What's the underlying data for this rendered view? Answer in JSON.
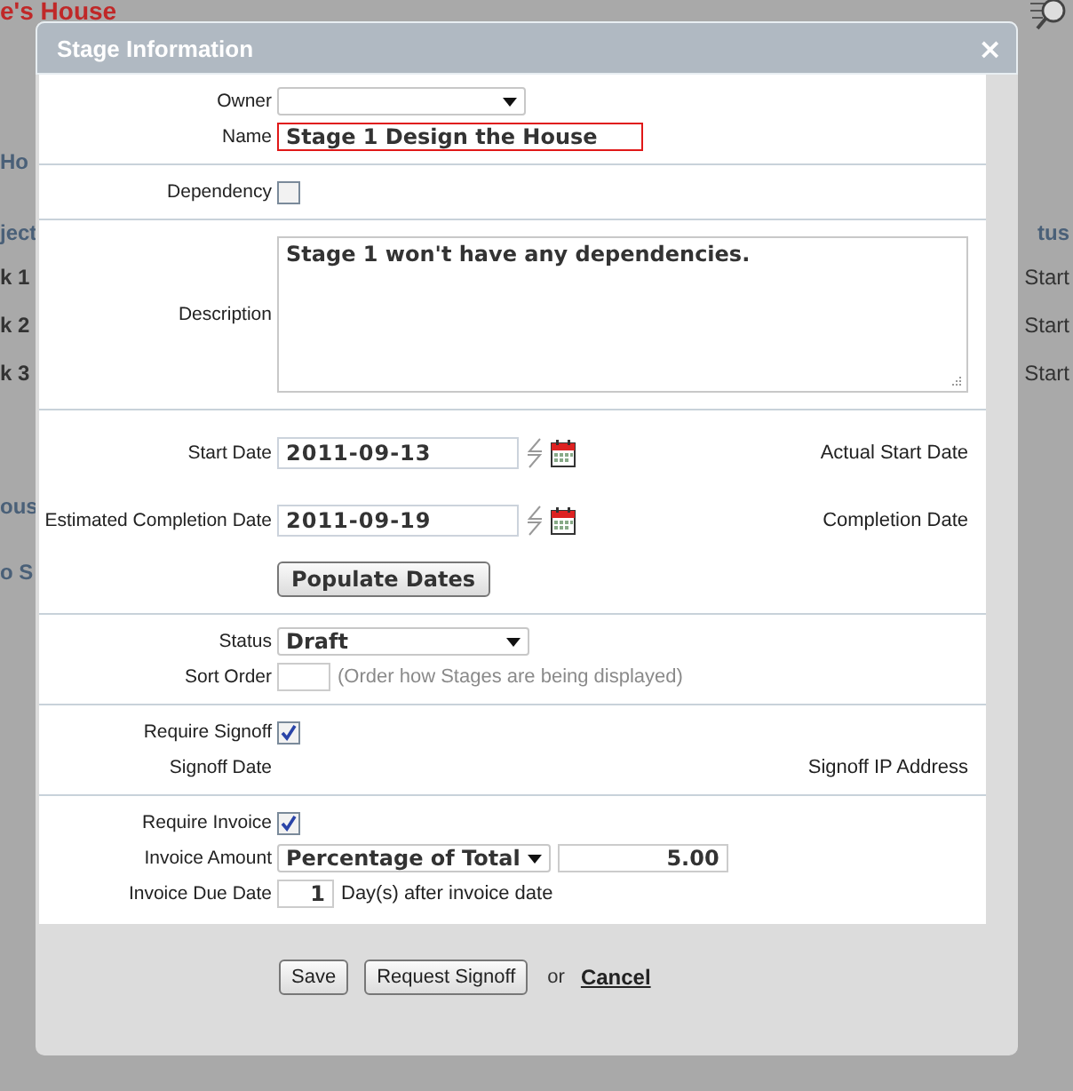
{
  "background": {
    "title": "e's House",
    "heading": "Ho",
    "rows": [
      {
        "column_1": "ject",
        "column_2": "tus",
        "kind": "header"
      },
      {
        "column_1": "k 1",
        "column_2": "Start",
        "kind": "row"
      },
      {
        "column_1": "k 2",
        "column_2": "Start",
        "kind": "row"
      },
      {
        "column_1": "k 3",
        "column_2": "Start",
        "kind": "row"
      }
    ],
    "section_1": "ous",
    "section_2": "o S"
  },
  "dialog": {
    "title": "Stage Information",
    "close": "×",
    "sections": [
      [
        {
          "kind": "select",
          "label": "Owner"
        },
        {
          "kind": "text",
          "label": "Name",
          "value": "Stage 1 Design the House",
          "error": true
        }
      ],
      [
        {
          "kind": "checkbox",
          "label": "Dependency",
          "checked": false
        }
      ],
      [
        {
          "kind": "textarea",
          "label": "Description",
          "value": "Stage 1 won't have any dependencies."
        }
      ],
      [
        {
          "kind": "date",
          "label": "Start Date",
          "value": "2011-09-13",
          "aside": "Actual Start Date"
        },
        {
          "kind": "date",
          "label": "Estimated Completion Date",
          "value": "2011-09-19",
          "aside": "Completion Date"
        },
        {
          "kind": "button",
          "label": "Populate Dates"
        }
      ],
      [
        {
          "kind": "select",
          "label": "Status",
          "value": "Draft"
        },
        {
          "kind": "order",
          "label": "Sort Order",
          "hint": "(Order how Stages are being displayed)"
        }
      ],
      [
        {
          "kind": "checkbox",
          "label": "Require Signoff",
          "checked": true
        },
        {
          "kind": "info",
          "label": "Signoff Date",
          "aside": "Signoff IP Address"
        }
      ],
      [
        {
          "kind": "checkbox",
          "label": "Require Invoice",
          "checked": true
        },
        {
          "kind": "amount",
          "label": "Invoice Amount",
          "value": "Percentage of Total",
          "amount": "5.00"
        },
        {
          "kind": "days",
          "label": "Invoice Due Date",
          "value": "1",
          "suffix": "Day(s) after invoice date"
        }
      ]
    ],
    "footer": {
      "buttons": [
        "Save",
        "Request Signoff"
      ],
      "separator": "or",
      "link": "Cancel"
    }
  }
}
